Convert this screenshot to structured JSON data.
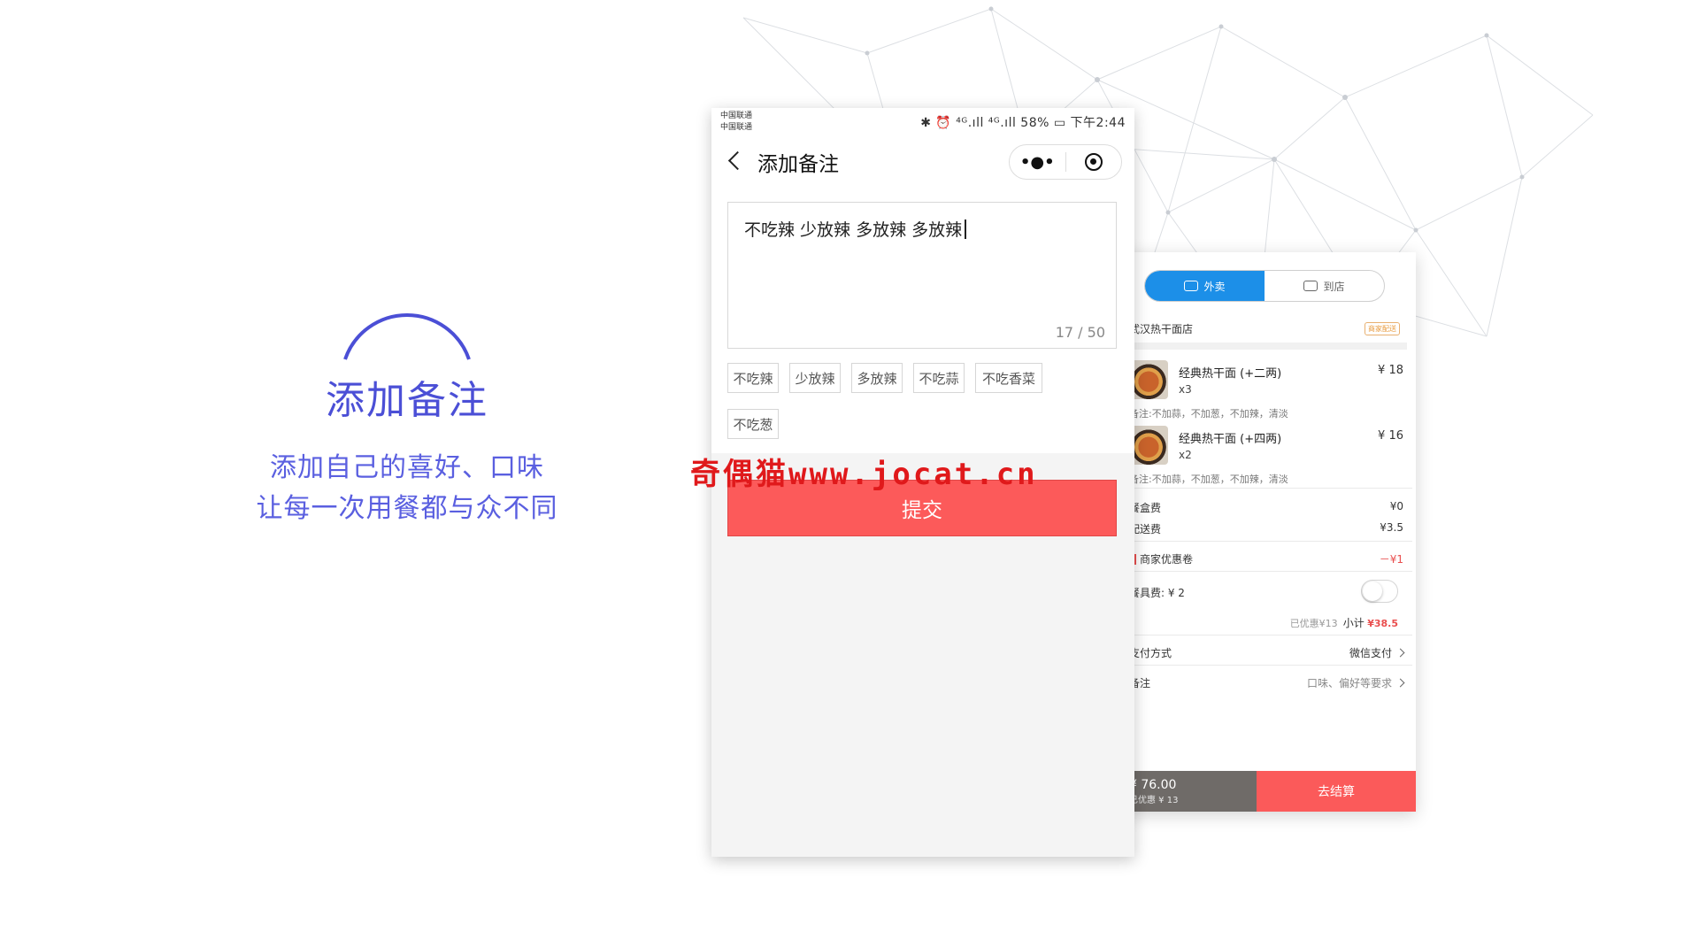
{
  "intro": {
    "title": "添加备注",
    "subtitle_line1": "添加自己的喜好、口味",
    "subtitle_line2": "让每一次用餐都与众不同"
  },
  "status_bar": {
    "carrier_1": "中国联通",
    "carrier_2": "中国联通",
    "right": "✱ ⏰ ⁴ᴳ.ıll ⁴ᴳ.ıll 58% ▭ 下午2:44"
  },
  "nav": {
    "title": "添加备注",
    "more_label": "•●•"
  },
  "remark": {
    "value": "不吃辣 少放辣 多放辣 多放辣",
    "count": "17 / 50"
  },
  "tags": [
    "不吃辣",
    "少放辣",
    "多放辣",
    "不吃蒜",
    "不吃香菜",
    "不吃葱"
  ],
  "submit_label": "提交",
  "watermark": "奇偶猫www.jocat.cn",
  "order": {
    "tab_delivery": "外卖",
    "tab_dinein": "到店",
    "shop_name": "武汉热干面店",
    "shop_badge": "商家配送",
    "items": [
      {
        "name": "经典热干面 (+二两)",
        "qty": "x3",
        "price": "¥ 18",
        "note": "备注:不加蒜，不加葱，不加辣，清淡"
      },
      {
        "name": "经典热干面 (+四两)",
        "qty": "x2",
        "price": "¥ 16",
        "note": "备注:不加蒜，不加葱，不加辣，清淡"
      }
    ],
    "box_fee_label": "餐盒费",
    "box_fee": "¥0",
    "delivery_fee_label": "配送费",
    "delivery_fee": "¥3.5",
    "coupon_label": "商家优惠卷",
    "coupon_value": "－¥1",
    "cutlery_label": "餐具费: ¥ 2",
    "discounted": "已优惠¥13",
    "subtotal_label": "小计",
    "subtotal": "¥38.5",
    "payment_label": "支付方式",
    "payment_value": "微信支付",
    "note_label": "备注",
    "note_value": "口味、偏好等要求",
    "total": "¥ 76.00",
    "total_discount": "已优惠 ¥ 13",
    "checkout_label": "去结算"
  },
  "colors": {
    "accent_blue": "#1c8fe8",
    "submit_red": "#fc5a5a",
    "intro_purple": "#4b4fd6"
  }
}
